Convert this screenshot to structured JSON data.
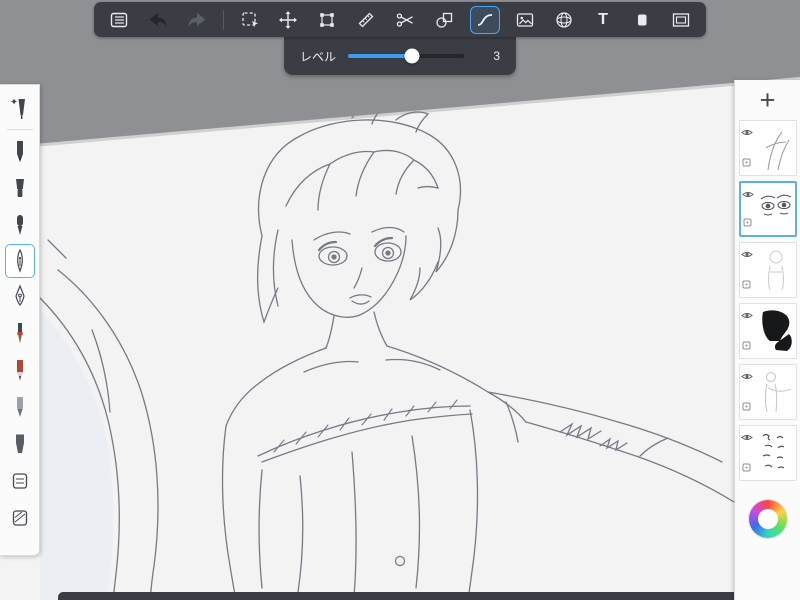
{
  "app": {
    "name": "paint-canvas-view"
  },
  "toolbar": {
    "text_glyph": "T",
    "items": [
      {
        "name": "menu"
      },
      {
        "name": "undo",
        "enabled": true
      },
      {
        "name": "redo",
        "enabled": false
      },
      {
        "name": "marquee-select"
      },
      {
        "name": "move"
      },
      {
        "name": "transform"
      },
      {
        "name": "ruler"
      },
      {
        "name": "scissors"
      },
      {
        "name": "shape"
      },
      {
        "name": "curve",
        "selected": true
      },
      {
        "name": "image"
      },
      {
        "name": "mesh"
      },
      {
        "name": "text"
      },
      {
        "name": "material"
      },
      {
        "name": "frame"
      }
    ]
  },
  "slider": {
    "label": "レベル",
    "value": "3",
    "percent": 55
  },
  "left_toolbar": {
    "tools": [
      {
        "name": "blend-pen"
      },
      {
        "name": "pencil"
      },
      {
        "name": "chisel-eraser"
      },
      {
        "name": "ink-pen"
      },
      {
        "name": "pen",
        "selected": true
      },
      {
        "name": "nib-pen"
      },
      {
        "name": "brush"
      },
      {
        "name": "red-pencil"
      },
      {
        "name": "gray-pen"
      },
      {
        "name": "marker"
      },
      {
        "name": "material-a"
      },
      {
        "name": "material-b"
      }
    ]
  },
  "layers": {
    "add_label": "+",
    "items": [
      {
        "thumb": "figure-sketch",
        "selected": false
      },
      {
        "thumb": "eyes-sketch",
        "selected": true
      },
      {
        "thumb": "faint-body-sketch",
        "selected": false
      },
      {
        "thumb": "black-silhouette",
        "selected": false
      },
      {
        "thumb": "faint-figure-sketch",
        "selected": false
      },
      {
        "thumb": "handwritten-notes",
        "selected": false
      }
    ]
  },
  "colors": {
    "accent": "#4da3ef",
    "toolbar_bg": "#3a3e44",
    "canvas": "#f3f3f4",
    "surround": "#8f9093",
    "panel": "#fbfbfc",
    "selection": "#59b2ea"
  }
}
